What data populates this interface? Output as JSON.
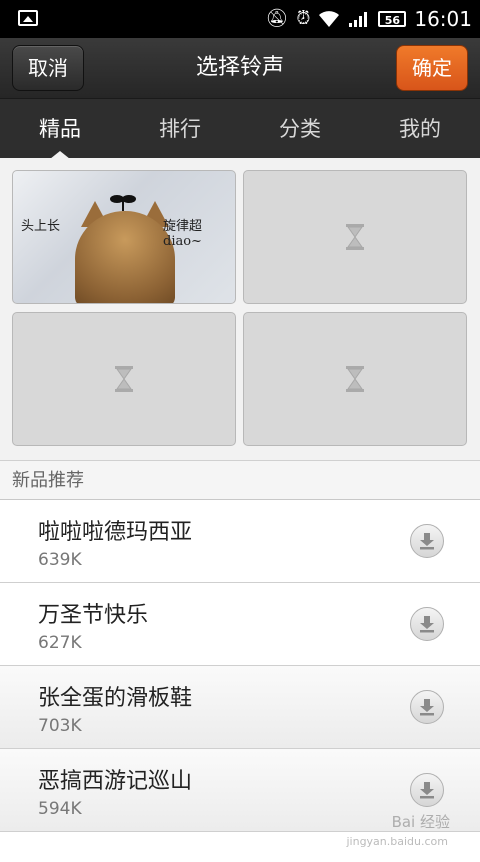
{
  "status_bar": {
    "time": "16:01",
    "battery": "56"
  },
  "header": {
    "cancel_label": "取消",
    "title": "选择铃声",
    "ok_label": "确定",
    "ok_color": "#e8651f"
  },
  "tabs": [
    {
      "label": "精品",
      "active": true
    },
    {
      "label": "排行",
      "active": false
    },
    {
      "label": "分类",
      "active": false
    },
    {
      "label": "我的",
      "active": false
    }
  ],
  "featured": {
    "banner_text_left": "头上长",
    "banner_text_right": "旋律超diao~"
  },
  "section_title": "新品推荐",
  "ringtones": [
    {
      "name": "啦啦啦德玛西亚",
      "size": "639K"
    },
    {
      "name": "万圣节快乐",
      "size": "627K"
    },
    {
      "name": "张全蛋的滑板鞋",
      "size": "703K"
    },
    {
      "name": "恶搞西游记巡山",
      "size": "594K"
    }
  ],
  "watermark": {
    "text": "Bai 经验",
    "sub": "jingyan.baidu.com"
  }
}
